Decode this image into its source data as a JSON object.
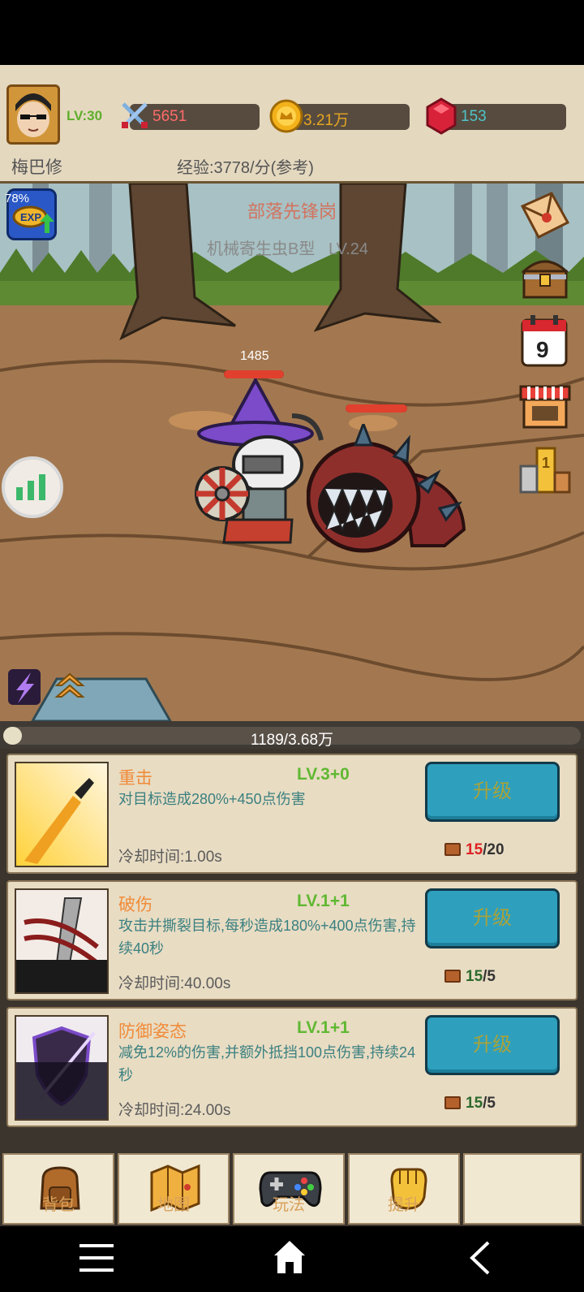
{
  "header": {
    "level": "LV:30",
    "attack": "5651",
    "gold": "3.21万",
    "gems": "153",
    "player_name": "梅巴修",
    "exp_rate": "经验:3778/分(参考)"
  },
  "scene": {
    "exp_percent": "78%",
    "stage_name": "部落先锋岗",
    "enemy_name": "机械寄生虫B型",
    "enemy_level": "LV.24",
    "player_hp": "1485",
    "player_hp_fraction": 1.0,
    "enemy_hp_fraction": 1.0,
    "calendar_day": "9",
    "rank_number": "1",
    "side_icons": [
      "mail-icon",
      "treasure-chest-icon",
      "calendar-icon",
      "shop-icon",
      "ranking-icon"
    ]
  },
  "progress": {
    "text": "1189/3.68万",
    "fraction": 0.032
  },
  "skills": [
    {
      "name": "重击",
      "level": "LV.3+0",
      "desc": "对目标造成280%+450点伤害",
      "cooldown": "冷却时间:1.00s",
      "button": "升级",
      "books_have": "15",
      "books_need": "/20",
      "insufficient": true
    },
    {
      "name": "破伤",
      "level": "LV.1+1",
      "desc": "攻击并撕裂目标,每秒造成180%+400点伤害,持续40秒",
      "cooldown": "冷却时间:40.00s",
      "button": "升级",
      "books_have": "15",
      "books_need": "/5",
      "insufficient": false
    },
    {
      "name": "防御姿态",
      "level": "LV.1+1",
      "desc": "减免12%的伤害,并额外抵挡100点伤害,持续24秒",
      "cooldown": "冷却时间:24.00s",
      "button": "升级",
      "books_have": "15",
      "books_need": "/5",
      "insufficient": false
    }
  ],
  "tabs": [
    {
      "label": "背包",
      "icon": "backpack-icon"
    },
    {
      "label": "地图",
      "icon": "map-icon"
    },
    {
      "label": "玩法",
      "icon": "gamepad-icon"
    },
    {
      "label": "提升",
      "icon": "fist-icon"
    }
  ],
  "colors": {
    "accent_button": "#2ea0be",
    "skill_name": "#f08b3a",
    "skill_level": "#60b832",
    "desc_text": "#3b8080"
  }
}
